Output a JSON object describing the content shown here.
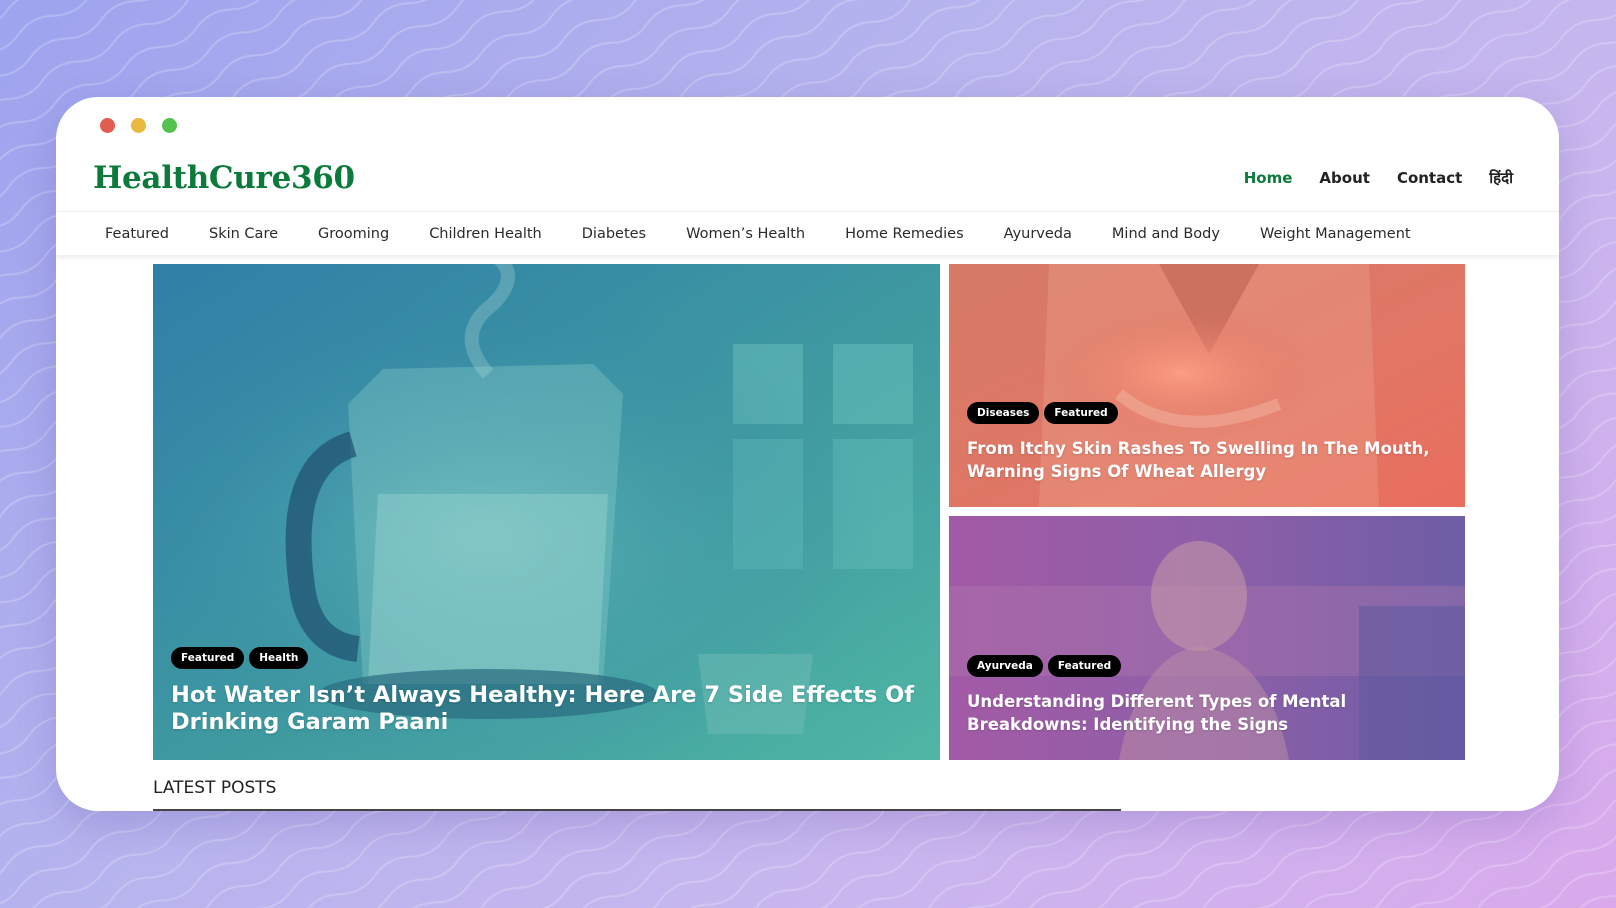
{
  "colors": {
    "brand_green": "#0c7a3a",
    "tag_bg": "#000000",
    "traffic_red": "#e25c52",
    "traffic_yellow": "#e9b83f",
    "traffic_green": "#55c151"
  },
  "site": {
    "logo": "HealthCure360"
  },
  "top_nav": [
    {
      "label": "Home",
      "active": true
    },
    {
      "label": "About",
      "active": false
    },
    {
      "label": "Contact",
      "active": false
    },
    {
      "label": "हिंदी",
      "active": false
    }
  ],
  "categories": [
    "Featured",
    "Skin Care",
    "Grooming",
    "Children Health",
    "Diabetes",
    "Women’s Health",
    "Home Remedies",
    "Ayurveda",
    "Mind and Body",
    "Weight Management"
  ],
  "featured_posts": [
    {
      "tags": [
        "Featured",
        "Health"
      ],
      "title": "Hot Water Isn’t Always Healthy: Here Are 7 Side Effects Of Drinking Garam Paani",
      "image": "glass-kettle-photo"
    },
    {
      "tags": [
        "Diseases",
        "Featured"
      ],
      "title": "From Itchy Skin Rashes To Swelling In The Mouth, Warning Signs Of Wheat Allergy",
      "image": "stomach-pain-photo"
    },
    {
      "tags": [
        "Ayurveda",
        "Featured"
      ],
      "title": "Understanding Different Types of Mental Breakdowns: Identifying the Signs",
      "image": "stressed-woman-photo"
    }
  ],
  "latest_posts": {
    "heading": "LATEST POSTS"
  }
}
